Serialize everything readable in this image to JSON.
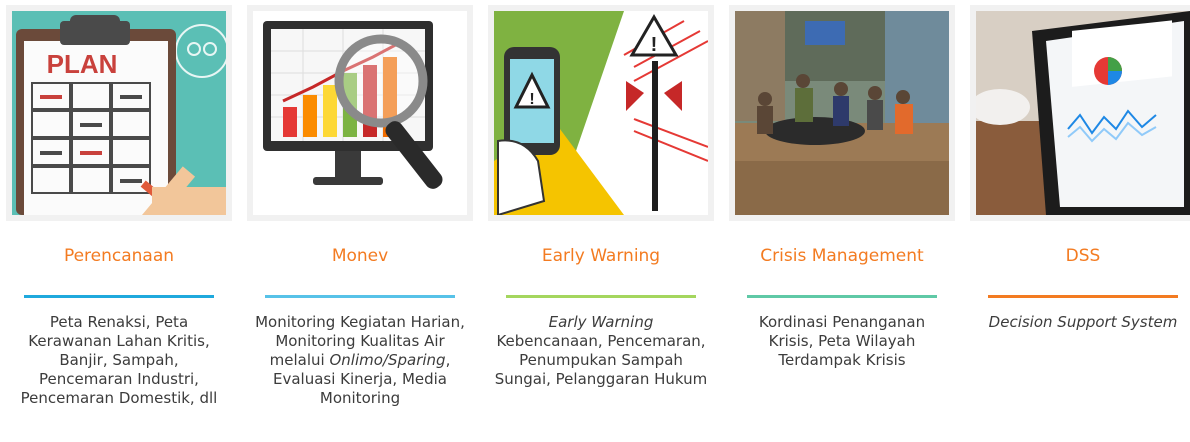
{
  "cards": [
    {
      "title": "Perencanaan",
      "image_text": "PLAN",
      "accent_color": "#1fa9dd",
      "desc": [
        {
          "text": "Peta Renaksi, Peta Kerawanan Lahan Kritis, Banjir, Sampah, Pencemaran Industri, Pencemaran Domestik, dll"
        }
      ]
    },
    {
      "title": "Monev",
      "accent_color": "#57c2e8",
      "desc": [
        {
          "text": "Monitoring Kegiatan Harian, Monitoring Kualitas Air melalui "
        },
        {
          "text": "Onlimo/Sparing",
          "italic": true
        },
        {
          "text": ", Evaluasi Kinerja, Media Monitoring"
        }
      ]
    },
    {
      "title": "Early Warning",
      "accent_color": "#a4d65e",
      "desc": [
        {
          "text": "Early Warning",
          "italic": true
        },
        {
          "text": " Kebencanaan, Pencemaran, Penumpukan Sampah Sungai, Pelanggaran Hukum"
        }
      ]
    },
    {
      "title": "Crisis Management",
      "accent_color": "#5fc9a6",
      "desc": [
        {
          "text": "Kordinasi Penanganan Krisis, Peta Wilayah Terdampak Krisis"
        }
      ]
    },
    {
      "title": "DSS",
      "accent_color": "#f37b21",
      "desc": [
        {
          "text": "Decision Support System",
          "italic": true
        }
      ]
    }
  ]
}
